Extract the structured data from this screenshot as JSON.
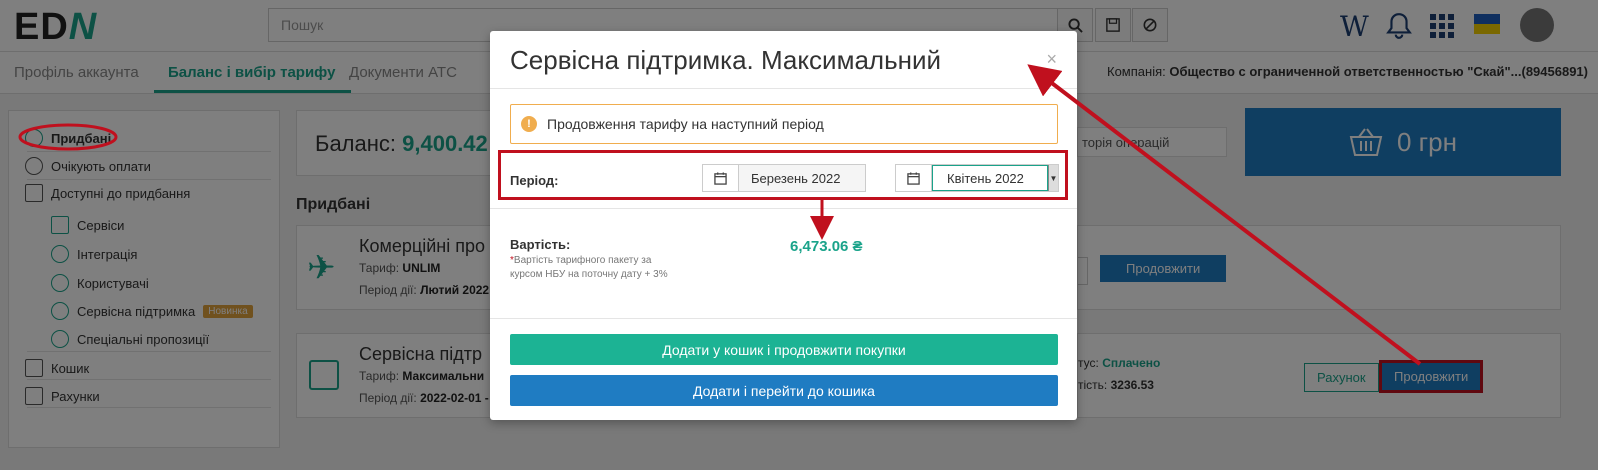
{
  "header": {
    "logo_left": "ED",
    "logo_right": "N",
    "search_placeholder": "Пошук",
    "search_icon": "search-icon",
    "save_icon": "save-icon",
    "clear_icon": "block-icon",
    "wiki_glyph": "W",
    "bell_icon": "bell-icon",
    "apps_icon": "grid-icon",
    "flag_colors": [
      "#1f5fbf",
      "#f5d000"
    ]
  },
  "tabs": [
    {
      "label": "Профіль аккаунта"
    },
    {
      "label": "Баланс і вибір тарифу"
    },
    {
      "label": "Документи АТС"
    }
  ],
  "company": {
    "label": "Компанія:",
    "name": "Общество с ограниченной ответственностью \"Скай\"...(89456891)"
  },
  "sidebar": {
    "items": [
      {
        "label": "Придбані"
      },
      {
        "label": "Очікують оплати"
      },
      {
        "label": "Доступні до придбання"
      },
      {
        "label": "Сервіси"
      },
      {
        "label": "Інтеграція"
      },
      {
        "label": "Користувачі"
      },
      {
        "label": "Сервісна підтримка"
      },
      {
        "label": "Спеціальні пропозиції"
      },
      {
        "label": "Кошик"
      },
      {
        "label": "Рахунки"
      }
    ],
    "badge": "Новинка"
  },
  "balance": {
    "label": "Баланс:",
    "value": "9,400.42"
  },
  "history_placeholder": "торія операцій",
  "cart_total": "0 грн",
  "purchased_title": "Придбані",
  "cards": [
    {
      "title": "Комерційні про",
      "tariff_label": "Тариф:",
      "tariff": "UNLIM",
      "period_label": "Період дії:",
      "period": "Лютий 2022",
      "button": "Продовжити"
    },
    {
      "title": "Сервісна підтр",
      "tariff_label": "Тариф:",
      "tariff": "Максимальни",
      "period_label": "Період дії:",
      "period": "2022-02-01 -",
      "status_label": "тус:",
      "status": "Сплачено",
      "cost_label": "тість:",
      "cost": "3236.53",
      "invoice_button": "Рахунок",
      "button": "Продовжити"
    }
  ],
  "modal": {
    "title": "Сервісна підтримка. Максимальний",
    "close": "×",
    "alert_text": "Продовження тарифу на наступний період",
    "period_label": "Період:",
    "period_from": "Березень 2022",
    "period_to": "Квітень 2022",
    "cost_label": "Вартість:",
    "cost_note_star": "*",
    "cost_note": "Вартість тарифного пакету за курсом НБУ на поточну дату + 3%",
    "cost_value": "6,473.06 ₴",
    "btn_add_continue": "Додати у кошик і продовжити покупки",
    "btn_add_go": "Додати і перейти до кошика"
  }
}
